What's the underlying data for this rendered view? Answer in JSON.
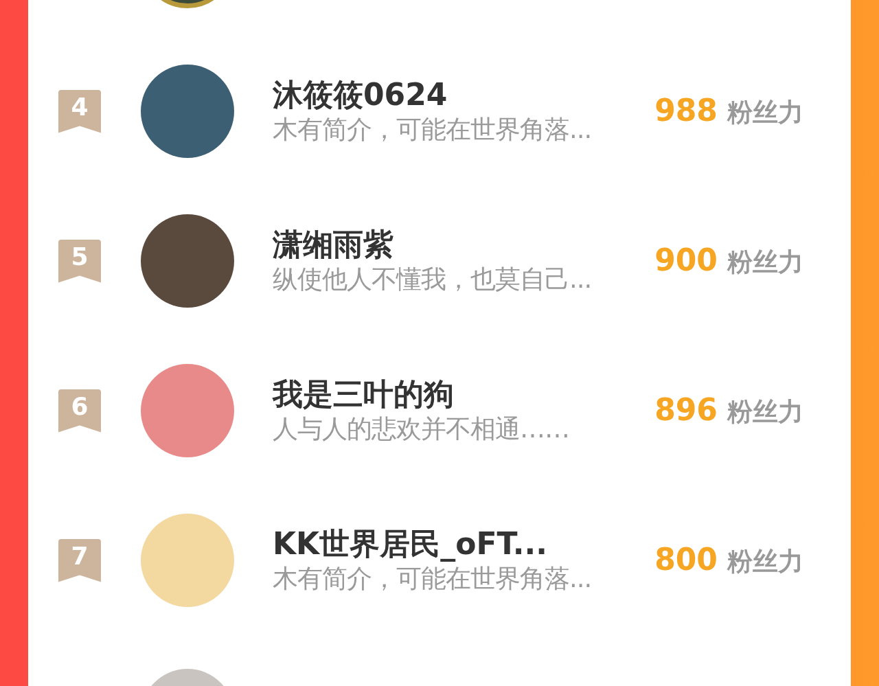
{
  "ranking": [
    {
      "rank": "4",
      "name": "沐筱筱0624",
      "bio": "木有简介，可能在世界角落...",
      "score": "988",
      "unit": "粉丝力"
    },
    {
      "rank": "5",
      "name": "潇缃雨紫",
      "bio": "纵使他人不懂我，也莫自己...",
      "score": "900",
      "unit": "粉丝力"
    },
    {
      "rank": "6",
      "name": "我是三叶的狗",
      "bio": "人与人的悲欢并不相通……",
      "score": "896",
      "unit": "粉丝力"
    },
    {
      "rank": "7",
      "name": "KK世界居民_oFT...",
      "bio": "木有简介，可能在世界角落...",
      "score": "800",
      "unit": "粉丝力"
    }
  ]
}
